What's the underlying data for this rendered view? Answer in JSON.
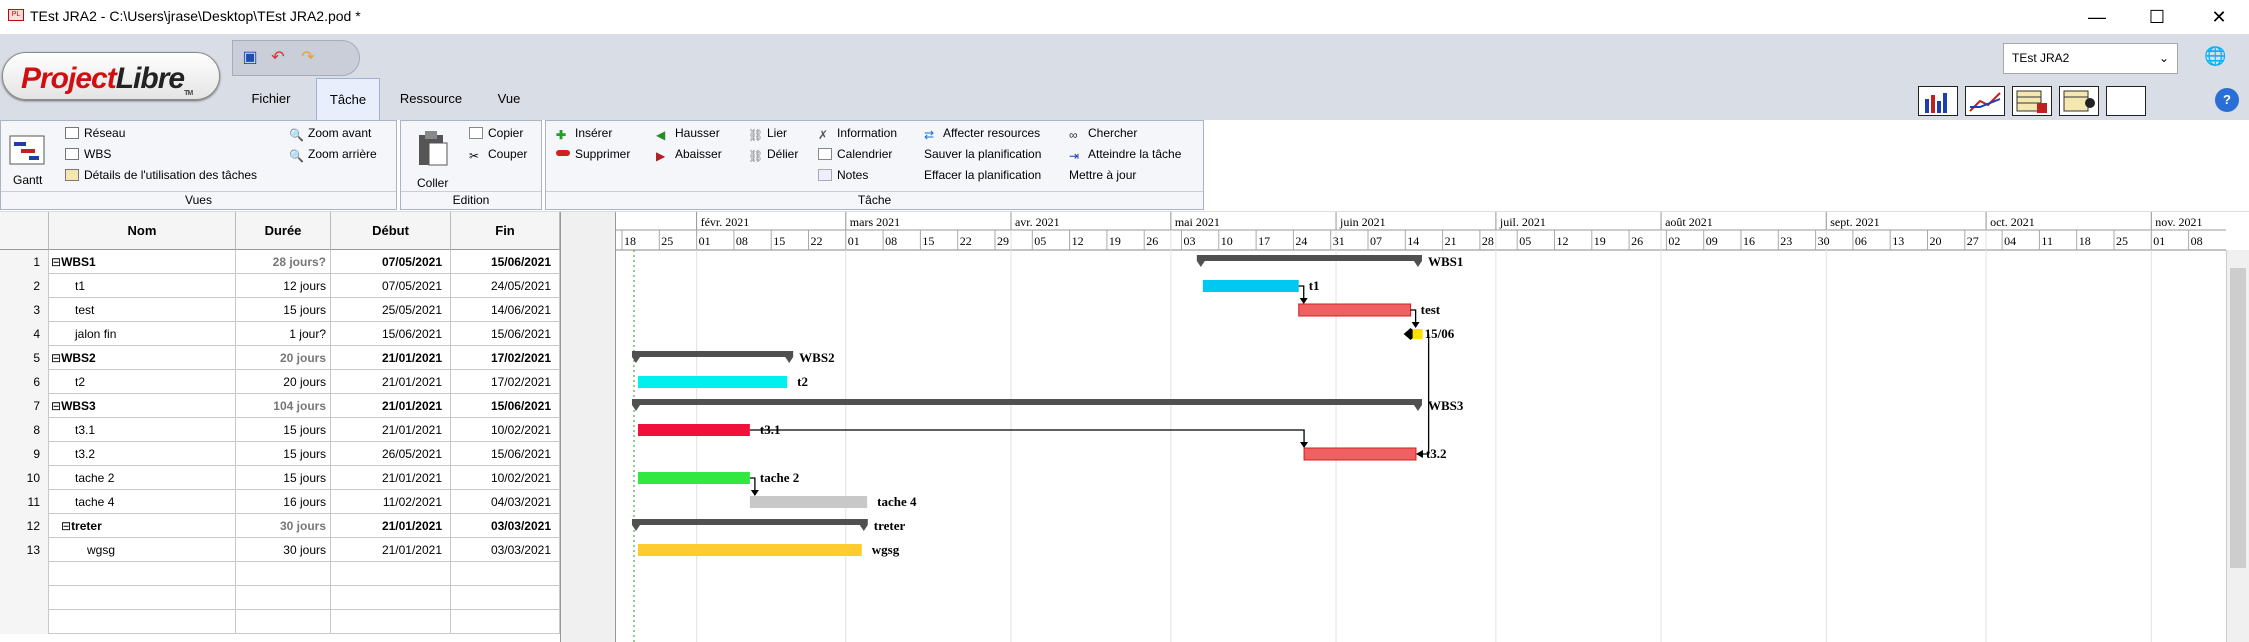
{
  "window": {
    "title": "TEst JRA2 - C:\\Users\\jrase\\Desktop\\TEst JRA2.pod *",
    "app_icon": "PL",
    "minimize": "—",
    "maximize": "☐",
    "close": "✕"
  },
  "logo": {
    "part1": "Project",
    "part2": "Libre",
    "tm": "TM"
  },
  "tabs": [
    "Fichier",
    "Tâche",
    "Ressource",
    "Vue"
  ],
  "project_combo": "TEst JRA2",
  "ribbon": {
    "vues": {
      "title": "Vues",
      "gantt": "Gantt",
      "reseau": "Réseau",
      "wbs": "WBS",
      "details": "Détails de l'utilisation des tâches",
      "zoom_avant": "Zoom avant",
      "zoom_arriere": "Zoom arrière"
    },
    "edition": {
      "title": "Edition",
      "coller": "Coller",
      "copier": "Copier",
      "couper": "Couper"
    },
    "tache": {
      "title": "Tâche",
      "inserer": "Insérer",
      "supprimer": "Supprimer",
      "hausser": "Hausser",
      "abaisser": "Abaisser",
      "lier": "Lier",
      "delier": "Délier",
      "information": "Information",
      "calendrier": "Calendrier",
      "notes": "Notes",
      "affecter": "Affecter resources",
      "sauver": "Sauver la planification",
      "effacer": "Effacer la planification",
      "chercher": "Chercher",
      "atteindre": "Atteindre la tâche",
      "mettre": "Mettre à jour"
    }
  },
  "table": {
    "headers": [
      "Nom",
      "Durée",
      "Début",
      "Fin"
    ],
    "rows": [
      {
        "id": "1",
        "name": "WBS1",
        "dur": "28 jours?",
        "start": "07/05/2021",
        "end": "15/06/2021",
        "summary": true
      },
      {
        "id": "2",
        "name": "t1",
        "dur": "12 jours",
        "start": "07/05/2021",
        "end": "24/05/2021"
      },
      {
        "id": "3",
        "name": "test",
        "dur": "15 jours",
        "start": "25/05/2021",
        "end": "14/06/2021"
      },
      {
        "id": "4",
        "name": "jalon fin",
        "dur": "1 jour?",
        "start": "15/06/2021",
        "end": "15/06/2021"
      },
      {
        "id": "5",
        "name": "WBS2",
        "dur": "20 jours",
        "start": "21/01/2021",
        "end": "17/02/2021",
        "summary": true
      },
      {
        "id": "6",
        "name": "t2",
        "dur": "20 jours",
        "start": "21/01/2021",
        "end": "17/02/2021"
      },
      {
        "id": "7",
        "name": "WBS3",
        "dur": "104 jours",
        "start": "21/01/2021",
        "end": "15/06/2021",
        "summary": true
      },
      {
        "id": "8",
        "name": "t3.1",
        "dur": "15 jours",
        "start": "21/01/2021",
        "end": "10/02/2021"
      },
      {
        "id": "9",
        "name": "t3.2",
        "dur": "15 jours",
        "start": "26/05/2021",
        "end": "15/06/2021"
      },
      {
        "id": "10",
        "name": "tache 2",
        "dur": "15 jours",
        "start": "21/01/2021",
        "end": "10/02/2021"
      },
      {
        "id": "11",
        "name": "tache 4",
        "dur": "16 jours",
        "start": "11/02/2021",
        "end": "04/03/2021"
      },
      {
        "id": "12",
        "name": "treter",
        "dur": "30 jours",
        "start": "21/01/2021",
        "end": "03/03/2021",
        "summary": true
      },
      {
        "id": "13",
        "name": "wgsg",
        "dur": "30 jours",
        "start": "21/01/2021",
        "end": "03/03/2021"
      }
    ]
  },
  "timeline": {
    "months": [
      "févr. 2021",
      "mars 2021",
      "avr. 2021",
      "mai 2021",
      "juin 2021",
      "juil. 2021",
      "août 2021",
      "sept. 2021",
      "oct. 2021",
      "nov. 2021"
    ],
    "weeks": [
      "18",
      "25",
      "01",
      "08",
      "15",
      "22",
      "01",
      "08",
      "15",
      "22",
      "29",
      "05",
      "12",
      "19",
      "26",
      "03",
      "10",
      "17",
      "24",
      "31",
      "07",
      "14",
      "21",
      "28",
      "05",
      "12",
      "19",
      "26",
      "02",
      "09",
      "16",
      "23",
      "30",
      "06",
      "13",
      "20",
      "27",
      "04",
      "11",
      "18",
      "25",
      "01",
      "08"
    ]
  },
  "gantt_bars": [
    {
      "row": 1,
      "label": "WBS1",
      "start": "2021-05-07",
      "end": "2021-06-15",
      "kind": "summary"
    },
    {
      "row": 2,
      "label": "t1",
      "start": "2021-05-07",
      "end": "2021-05-24",
      "kind": "task",
      "color": "#00c8f0"
    },
    {
      "row": 3,
      "label": "test",
      "start": "2021-05-25",
      "end": "2021-06-14",
      "kind": "critical",
      "color": "#f06060"
    },
    {
      "row": 4,
      "label": "15/06",
      "start": "2021-06-15",
      "end": "2021-06-15",
      "kind": "milestone"
    },
    {
      "row": 5,
      "label": "WBS2",
      "start": "2021-01-21",
      "end": "2021-02-17",
      "kind": "summary"
    },
    {
      "row": 6,
      "label": "t2",
      "start": "2021-01-21",
      "end": "2021-02-17",
      "kind": "task",
      "color": "#00f0f0"
    },
    {
      "row": 7,
      "label": "WBS3",
      "start": "2021-01-21",
      "end": "2021-06-15",
      "kind": "summary"
    },
    {
      "row": 8,
      "label": "t3.1",
      "start": "2021-01-21",
      "end": "2021-02-10",
      "kind": "task",
      "color": "#f0103a"
    },
    {
      "row": 9,
      "label": "t3.2",
      "start": "2021-05-26",
      "end": "2021-06-15",
      "kind": "critical",
      "color": "#f06060"
    },
    {
      "row": 10,
      "label": "tache 2",
      "start": "2021-01-21",
      "end": "2021-02-10",
      "kind": "task",
      "color": "#30e840"
    },
    {
      "row": 11,
      "label": "tache 4",
      "start": "2021-02-11",
      "end": "2021-03-04",
      "kind": "task",
      "color": "#c8c8c8"
    },
    {
      "row": 12,
      "label": "treter",
      "start": "2021-01-21",
      "end": "2021-03-03",
      "kind": "summary"
    },
    {
      "row": 13,
      "label": "wgsg",
      "start": "2021-01-21",
      "end": "2021-03-03",
      "kind": "task",
      "color": "#ffcc30"
    }
  ],
  "colors": {
    "summary": "#505050",
    "link": "#000000",
    "today_line": "#2a9a2a"
  }
}
